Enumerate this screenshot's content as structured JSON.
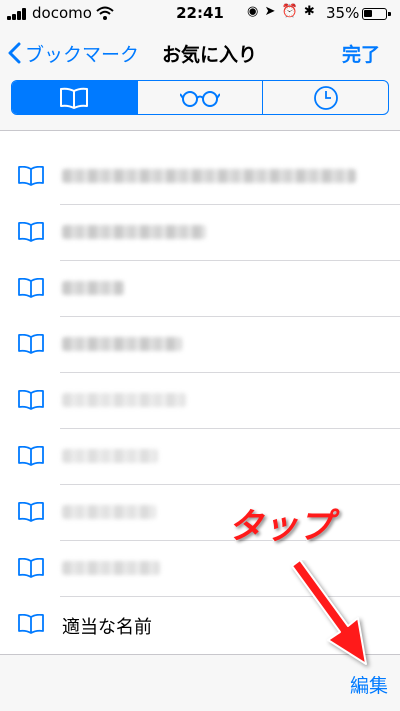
{
  "status_bar": {
    "carrier": "docomo",
    "time": "22:41",
    "icons": "◉ ➤ ⏰ ✱",
    "battery": "35%",
    "battery_level": 0.35
  },
  "nav": {
    "back_label": "ブックマーク",
    "title": "お気に入り",
    "done_label": "完了"
  },
  "segments": [
    {
      "icon": "book-icon",
      "selected": true
    },
    {
      "icon": "glasses-icon",
      "selected": false
    },
    {
      "icon": "clock-icon",
      "selected": false
    }
  ],
  "bookmarks": {
    "last_label": "適当な名前"
  },
  "toolbar": {
    "edit_label": "編集"
  },
  "annotation": {
    "text": "タップ",
    "color": "#ff1a1a"
  },
  "colors": {
    "accent": "#007aff"
  }
}
